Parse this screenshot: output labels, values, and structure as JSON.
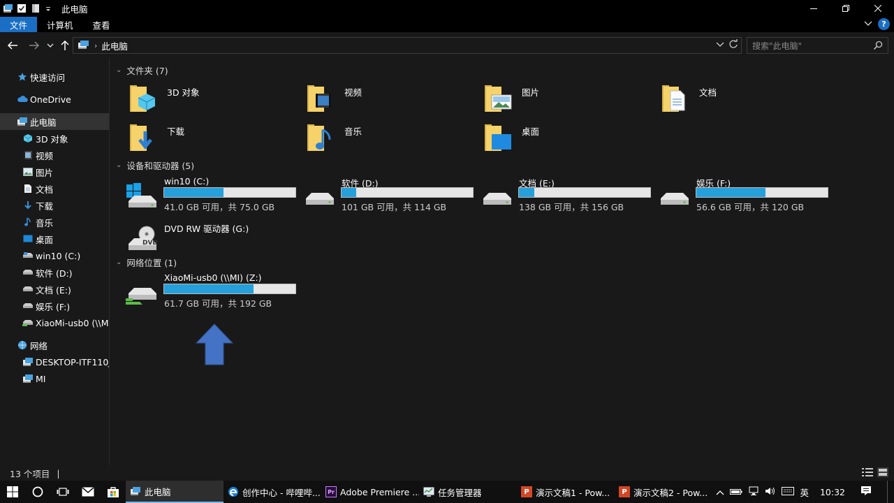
{
  "window": {
    "title": "此电脑",
    "minimize_icon": "minimize-icon",
    "maximize_icon": "maximize-icon",
    "close_icon": "close-icon"
  },
  "ribbon": {
    "tabs": [
      "文件",
      "计算机",
      "查看"
    ],
    "help": "?"
  },
  "address": {
    "crumb": "此电脑",
    "search_placeholder": "搜索\"此电脑\""
  },
  "sidebar": {
    "items": [
      {
        "label": "快速访问",
        "icon": "star-icon"
      },
      {
        "label": "OneDrive",
        "icon": "cloud-icon"
      },
      {
        "label": "此电脑",
        "icon": "computer-icon",
        "selected": true
      },
      {
        "label": "3D 对象",
        "icon": "cube-icon"
      },
      {
        "label": "视频",
        "icon": "video-icon"
      },
      {
        "label": "图片",
        "icon": "picture-icon"
      },
      {
        "label": "文档",
        "icon": "document-icon"
      },
      {
        "label": "下载",
        "icon": "download-icon"
      },
      {
        "label": "音乐",
        "icon": "music-icon"
      },
      {
        "label": "桌面",
        "icon": "desktop-icon"
      },
      {
        "label": "win10 (C:)",
        "icon": "drive-icon"
      },
      {
        "label": "软件 (D:)",
        "icon": "drive-icon"
      },
      {
        "label": "文档 (E:)",
        "icon": "drive-icon"
      },
      {
        "label": "娱乐 (F:)",
        "icon": "drive-icon"
      },
      {
        "label": "XiaoMi-usb0 (\\\\MI",
        "icon": "network-drive-icon"
      },
      {
        "label": "网络",
        "icon": "network-icon"
      },
      {
        "label": "DESKTOP-ITF110J",
        "icon": "computer-icon"
      },
      {
        "label": "MI",
        "icon": "computer-icon"
      }
    ]
  },
  "groups": {
    "folders": {
      "header": "文件夹 (7)",
      "items": [
        "3D 对象",
        "视频",
        "图片",
        "文档",
        "下载",
        "音乐",
        "桌面"
      ]
    },
    "drives": {
      "header": "设备和驱动器 (5)",
      "items": [
        {
          "name": "win10 (C:)",
          "size": "41.0 GB 可用，共 75.0 GB",
          "used_fraction": 0.453
        },
        {
          "name": "软件 (D:)",
          "size": "101 GB 可用，共 114 GB",
          "used_fraction": 0.114
        },
        {
          "name": "文档 (E:)",
          "size": "138 GB 可用，共 156 GB",
          "used_fraction": 0.115
        },
        {
          "name": "娱乐 (F:)",
          "size": "56.6 GB 可用，共 120 GB",
          "used_fraction": 0.528
        }
      ],
      "dvd": {
        "name": "DVD RW 驱动器 (G:)",
        "label": "DVD"
      }
    },
    "network": {
      "header": "网络位置 (1)",
      "item": {
        "name": "XiaoMi-usb0 (\\\\MI) (Z:)",
        "size": "61.7 GB 可用，共 192 GB",
        "used_fraction": 0.679
      }
    }
  },
  "status": {
    "count": "13 个项目",
    "cursor": "|"
  },
  "taskbar": {
    "apps": [
      {
        "label": "此电脑",
        "icon": "explorer-icon",
        "active": true
      },
      {
        "label": "创作中心 - 哔哩哔...",
        "icon": "edge-icon"
      },
      {
        "label": "Adobe Premiere ...",
        "icon": "premiere-icon",
        "icon_text": "Pr"
      },
      {
        "label": "任务管理器",
        "icon": "task-manager-icon"
      },
      {
        "label": "演示文稿1 - Pow...",
        "icon": "powerpoint-icon",
        "icon_text": "P"
      },
      {
        "label": "演示文稿2 - Pow...",
        "icon": "powerpoint-icon",
        "icon_text": "P"
      }
    ],
    "tray": {
      "ime": "英",
      "time": "10:32"
    }
  },
  "colors": {
    "accent": "#1a6fc4",
    "bar_fill": "#26a0da",
    "annotation_arrow": "#4472c4"
  }
}
